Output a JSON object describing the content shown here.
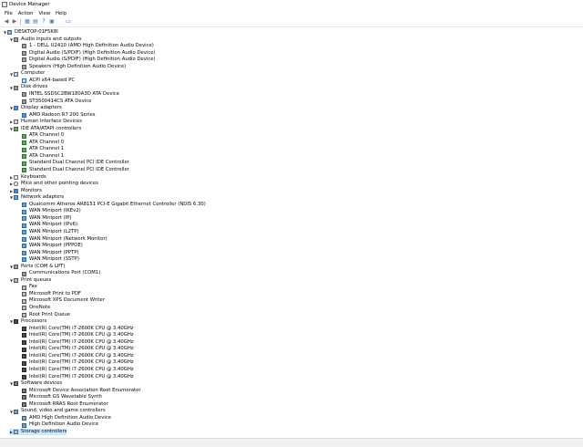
{
  "window": {
    "title": "Device Manager"
  },
  "menu": [
    "File",
    "Action",
    "View",
    "Help"
  ],
  "toolbar": [
    {
      "icon": "back-arrow-icon",
      "glyph": "◀",
      "color": "#6a6a6a"
    },
    {
      "icon": "forward-arrow-icon",
      "glyph": "▶",
      "color": "#6a6a6a"
    },
    {
      "icon": "properties-icon",
      "glyph": "▦",
      "color": "#4a78b0"
    },
    {
      "icon": "update-driver-icon",
      "glyph": "▤",
      "color": "#4a78b0"
    },
    {
      "icon": "help-icon",
      "glyph": "?",
      "color": "#2b64b8"
    },
    {
      "icon": "scan-hardware-icon",
      "glyph": "▣",
      "color": "#4a78b0"
    },
    {
      "icon": "monitor-icon",
      "glyph": "▭",
      "color": "#2b64b8"
    }
  ],
  "tree": [
    {
      "label": "DESKTOP-01F5K8I",
      "level": 0,
      "state": "open",
      "icon": "root"
    },
    {
      "label": "Audio inputs and outputs",
      "level": 1,
      "state": "open",
      "icon": "speaker"
    },
    {
      "label": "1 - DELL U2410 (AMD High Definition Audio Device)",
      "level": 2,
      "icon": "speaker"
    },
    {
      "label": "Digital Audio (S/PDIF) (High Definition Audio Device)",
      "level": 2,
      "icon": "speaker"
    },
    {
      "label": "Digital Audio (S/PDIF) (High Definition Audio Device)",
      "level": 2,
      "icon": "speaker"
    },
    {
      "label": "Speakers (High Definition Audio Device)",
      "level": 2,
      "icon": "speaker"
    },
    {
      "label": "Computer",
      "level": 1,
      "state": "open",
      "icon": "computer"
    },
    {
      "label": "ACPI x64-based PC",
      "level": 2,
      "icon": "computer"
    },
    {
      "label": "Disk drives",
      "level": 1,
      "state": "open",
      "icon": "disk"
    },
    {
      "label": "INTEL SSDSC2BW180A3D ATA Device",
      "level": 2,
      "icon": "disk"
    },
    {
      "label": "ST3500414CS ATA Device",
      "level": 2,
      "icon": "disk"
    },
    {
      "label": "Display adapters",
      "level": 1,
      "state": "open",
      "icon": "display"
    },
    {
      "label": "AMD Radeon R7 200 Series",
      "level": 2,
      "icon": "display"
    },
    {
      "label": "Human Interface Devices",
      "level": 1,
      "state": "closed",
      "icon": "hid"
    },
    {
      "label": "IDE ATA/ATAPI controllers",
      "level": 1,
      "state": "open",
      "icon": "ide"
    },
    {
      "label": "ATA Channel 0",
      "level": 2,
      "icon": "ide"
    },
    {
      "label": "ATA Channel 0",
      "level": 2,
      "icon": "ide"
    },
    {
      "label": "ATA Channel 1",
      "level": 2,
      "icon": "ide"
    },
    {
      "label": "ATA Channel 1",
      "level": 2,
      "icon": "ide"
    },
    {
      "label": "Standard Dual Channel PCI IDE Controller",
      "level": 2,
      "icon": "ide"
    },
    {
      "label": "Standard Dual Channel PCI IDE Controller",
      "level": 2,
      "icon": "ide"
    },
    {
      "label": "Keyboards",
      "level": 1,
      "state": "closed",
      "icon": "keyboard"
    },
    {
      "label": "Mice and other pointing devices",
      "level": 1,
      "state": "closed",
      "icon": "mouse"
    },
    {
      "label": "Monitors",
      "level": 1,
      "state": "closed",
      "icon": "monitor"
    },
    {
      "label": "Network adapters",
      "level": 1,
      "state": "open",
      "icon": "net"
    },
    {
      "label": "Qualcomm Atheros AR8151 PCI-E Gigabit Ethernet Controller (NDIS 6.30)",
      "level": 2,
      "icon": "net"
    },
    {
      "label": "WAN Miniport (IKEv2)",
      "level": 2,
      "icon": "net"
    },
    {
      "label": "WAN Miniport (IP)",
      "level": 2,
      "icon": "net"
    },
    {
      "label": "WAN Miniport (IPv6)",
      "level": 2,
      "icon": "net"
    },
    {
      "label": "WAN Miniport (L2TP)",
      "level": 2,
      "icon": "net"
    },
    {
      "label": "WAN Miniport (Network Monitor)",
      "level": 2,
      "icon": "net"
    },
    {
      "label": "WAN Miniport (PPPOE)",
      "level": 2,
      "icon": "net"
    },
    {
      "label": "WAN Miniport (PPTP)",
      "level": 2,
      "icon": "net"
    },
    {
      "label": "WAN Miniport (SSTP)",
      "level": 2,
      "icon": "net"
    },
    {
      "label": "Ports (COM & LPT)",
      "level": 1,
      "state": "open",
      "icon": "port"
    },
    {
      "label": "Communications Port (COM1)",
      "level": 2,
      "icon": "port"
    },
    {
      "label": "Print queues",
      "level": 1,
      "state": "open",
      "icon": "printer"
    },
    {
      "label": "Fax",
      "level": 2,
      "icon": "printer"
    },
    {
      "label": "Microsoft Print to PDF",
      "level": 2,
      "icon": "printer"
    },
    {
      "label": "Microsoft XPS Document Writer",
      "level": 2,
      "icon": "printer"
    },
    {
      "label": "OneNote",
      "level": 2,
      "icon": "printer"
    },
    {
      "label": "Root Print Queue",
      "level": 2,
      "icon": "printer"
    },
    {
      "label": "Processors",
      "level": 1,
      "state": "open",
      "icon": "cpu"
    },
    {
      "label": "Intel(R) Core(TM) i7-2600K CPU @ 3.40GHz",
      "level": 2,
      "icon": "cpu"
    },
    {
      "label": "Intel(R) Core(TM) i7-2600K CPU @ 3.40GHz",
      "level": 2,
      "icon": "cpu"
    },
    {
      "label": "Intel(R) Core(TM) i7-2600K CPU @ 3.40GHz",
      "level": 2,
      "icon": "cpu"
    },
    {
      "label": "Intel(R) Core(TM) i7-2600K CPU @ 3.40GHz",
      "level": 2,
      "icon": "cpu"
    },
    {
      "label": "Intel(R) Core(TM) i7-2600K CPU @ 3.40GHz",
      "level": 2,
      "icon": "cpu"
    },
    {
      "label": "Intel(R) Core(TM) i7-2600K CPU @ 3.40GHz",
      "level": 2,
      "icon": "cpu"
    },
    {
      "label": "Intel(R) Core(TM) i7-2600K CPU @ 3.40GHz",
      "level": 2,
      "icon": "cpu"
    },
    {
      "label": "Intel(R) Core(TM) i7-2600K CPU @ 3.40GHz",
      "level": 2,
      "icon": "cpu"
    },
    {
      "label": "Software devices",
      "level": 1,
      "state": "open",
      "icon": "software"
    },
    {
      "label": "Microsoft Device Association Root Enumerator",
      "level": 2,
      "icon": "software"
    },
    {
      "label": "Microsoft GS Wavetable Synth",
      "level": 2,
      "icon": "software"
    },
    {
      "label": "Microsoft RRAS Root Enumerator",
      "level": 2,
      "icon": "software"
    },
    {
      "label": "Sound, video and game controllers",
      "level": 1,
      "state": "open",
      "icon": "sound"
    },
    {
      "label": "AMD High Definition Audio Device",
      "level": 2,
      "icon": "sound"
    },
    {
      "label": "High Definition Audio Device",
      "level": 2,
      "icon": "sound"
    },
    {
      "label": "Storage controllers",
      "level": 1,
      "state": "closed",
      "icon": "storage",
      "selected": true
    }
  ]
}
